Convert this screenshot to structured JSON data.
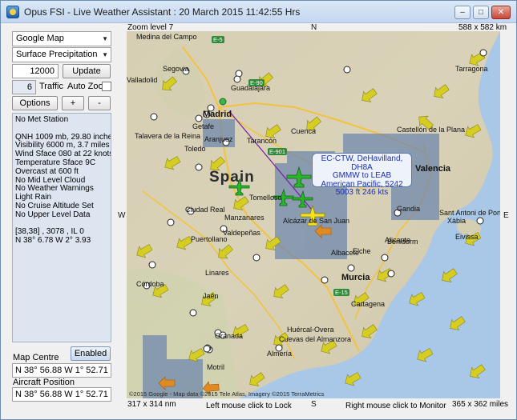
{
  "window": {
    "title": "Opus FSI - Live Weather Assistant : 20 March 2015  11:42:55 Hrs",
    "controls": {
      "minimize": "–",
      "maximize": "□",
      "close": "✕"
    }
  },
  "left_panel": {
    "map_type_select": "Google Map",
    "weather_select": "Surface Precipitation",
    "altitude_value": "12000",
    "update_label": "Update",
    "traffic_value": "6",
    "traffic_label": "Traffic",
    "auto_zoom_label": "Auto Zoom",
    "auto_zoom_checked": false,
    "options_label": "Options",
    "plus_label": "+",
    "minus_label": "-",
    "met_lines": [
      "No Met Station",
      "",
      "QNH 1009 mb, 29.80 inches",
      "Visibility 6000 m, 3.7 miles",
      "Wind Sface 080 at 22 knots",
      "Temperature Sface 9C",
      "Overcast at 600 ft",
      "No Mid Level Cloud",
      "No Weather Warnings",
      "Light Rain",
      "No Cruise Altitude Set",
      "No Upper Level Data",
      "",
      "[38,38] , 3078 , IL 0",
      "N 38° 6.78  W 2° 3.93"
    ],
    "enabled_label": "Enabled",
    "map_centre_label": "Map Centre",
    "map_centre_value": "N 38° 56.88  W 1° 52.71",
    "aircraft_position_label": "Aircraft Position",
    "aircraft_position_value": "N 38° 56.88  W 1° 52.71"
  },
  "map": {
    "zoom_level": "Zoom level 7",
    "size_km": "588 x 582 km",
    "north": "N",
    "south": "S",
    "east": "E",
    "west": "W",
    "size_nm": "317 x 314 nm",
    "left_click_hint": "Left mouse click to Lock",
    "right_click_hint": "Right mouse click to Monitor",
    "size_miles": "365 x 362 miles",
    "copyright": "©2015 Google - Map data ©2015 Tele Atlas, Imagery ©2015 TerraMetrics",
    "country_label": "Spain",
    "callout": {
      "line1": "EC-CTW, DeHavilland, DH8A",
      "line2": "GMMW to LEAB",
      "line3": "American Pacific, 5242",
      "line4": "5003 ft  246 kts"
    },
    "places": [
      "Medina del Campo",
      "Segovia",
      "Valladolid",
      "Guadalajara",
      "Madrid",
      "Getafe",
      "Aranjuez",
      "Toledo",
      "Talavera de la Reina",
      "Cuenca",
      "Tarancón",
      "Castellón de la Plana",
      "Valencia",
      "Albacete",
      "Ciudad Real",
      "Puertollano",
      "Manzanares",
      "Valdepeñas",
      "Tomelloso",
      "Linares",
      "Jaén",
      "Córdoba",
      "Granada",
      "Motril",
      "Almería",
      "Murcia",
      "Cartagena",
      "Alicante",
      "Elche",
      "Benidorm",
      "Gandia",
      "Xàbia",
      "Sant Antoni de Portmany",
      "Eivissa",
      "Tarragona",
      "Huércal-Overa",
      "Cuevas del Almanzora",
      "Alcázar de San Juan"
    ],
    "roads": [
      "E-5",
      "E-90",
      "E-901",
      "E-15"
    ]
  },
  "colors": {
    "callout_text": "#1c2fb2",
    "flight_path": "#7a1aa8",
    "aircraft_green": "#2bb52b",
    "aircraft_yellow": "#f5e21f",
    "wind_arrow": "#d6cd22",
    "precip": "#6c86ad"
  }
}
